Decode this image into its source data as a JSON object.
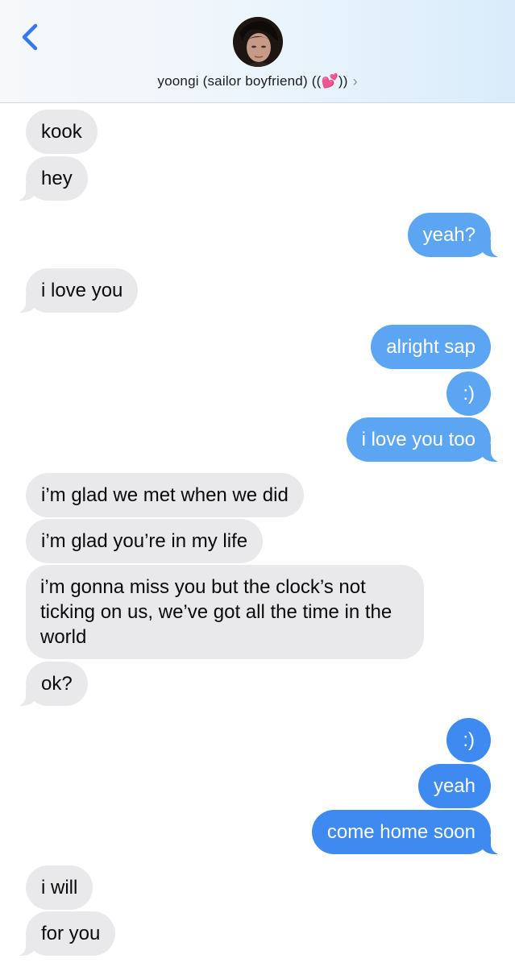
{
  "header": {
    "contact_name": "yoongi (sailor boyfriend) ((💕))",
    "chevron": "›",
    "back_icon": "chevron-left-icon"
  },
  "colors": {
    "sent_bubble": "#5ba5f2",
    "sent_bubble_dark": "#3e8af0",
    "received_bubble": "#e9e9eb",
    "back_button": "#3478f6"
  },
  "messages": [
    {
      "from": "them",
      "text": "kook"
    },
    {
      "from": "them",
      "text": "hey"
    },
    {
      "from": "me",
      "text": "yeah?"
    },
    {
      "from": "them",
      "text": "i love you"
    },
    {
      "from": "me",
      "text": "alright sap"
    },
    {
      "from": "me",
      "text": ":)"
    },
    {
      "from": "me",
      "text": "i love you too"
    },
    {
      "from": "them",
      "text": "i’m glad we met when we did"
    },
    {
      "from": "them",
      "text": "i’m glad you’re in my life"
    },
    {
      "from": "them",
      "text": "i’m gonna miss you but the clock’s not ticking on us, we’ve got all the time in the world"
    },
    {
      "from": "them",
      "text": "ok?"
    },
    {
      "from": "me",
      "text": ":)"
    },
    {
      "from": "me",
      "text": "yeah"
    },
    {
      "from": "me",
      "text": "come home soon"
    },
    {
      "from": "them",
      "text": "i will"
    },
    {
      "from": "them",
      "text": "for you"
    }
  ]
}
